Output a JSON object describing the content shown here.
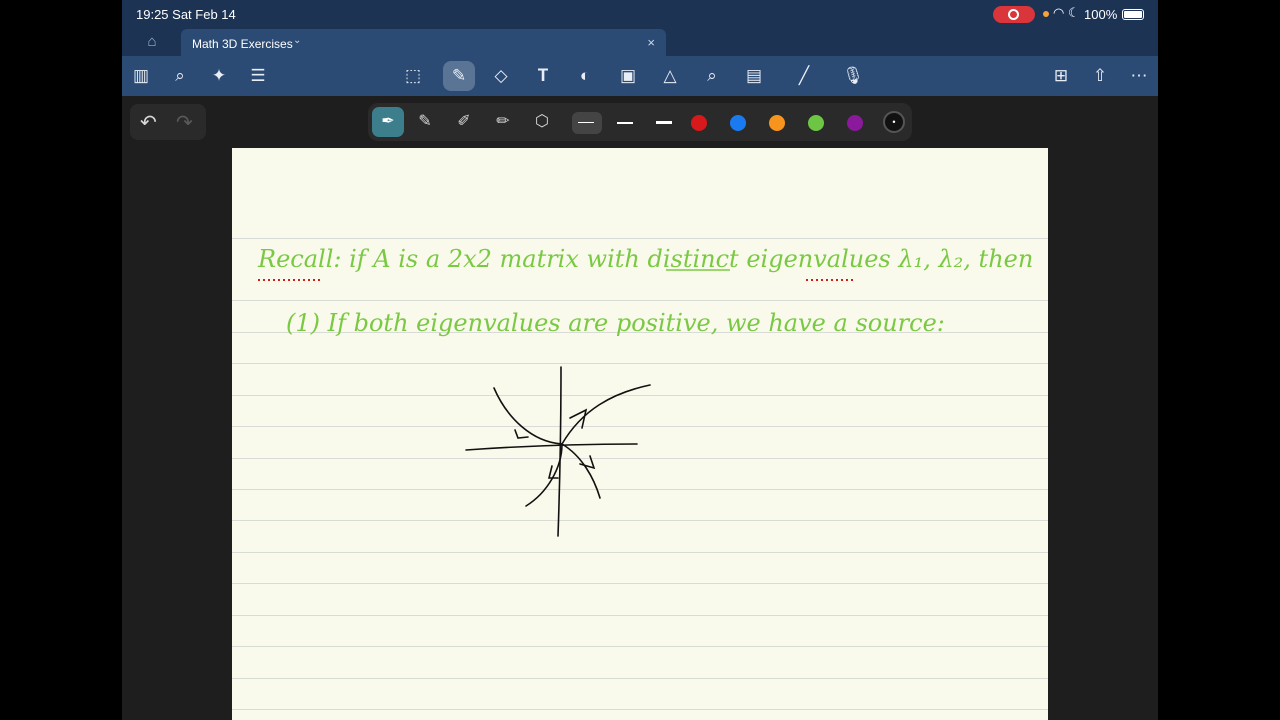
{
  "status_bar": {
    "time": "19:25  Sat Feb 14",
    "battery_pct": "100%"
  },
  "tab": {
    "title": "Math 3D Exercises",
    "chevron": "⌄",
    "close": "×"
  },
  "toolbar_icons": [
    "sidebar-icon",
    "search-icon",
    "ai-sparkle-icon",
    "document-icon",
    "lasso-icon",
    "pen-icon",
    "eraser-icon",
    "text-box-icon",
    "shapes-icon",
    "image-icon",
    "elements-icon",
    "highlighter-icon",
    "sticky-note-icon",
    "ruler-icon",
    "audio-record-icon",
    "add-page-icon",
    "share-icon",
    "more-icon"
  ],
  "pen_colors": [
    "#d7191c",
    "#1a7bf1",
    "#f7941d",
    "#6cc644",
    "#8a1a9b",
    "#111111"
  ],
  "note": {
    "line1": "Recall: if A is a 2x2 matrix with distinct eigenvalues λ₁, λ₂, then",
    "line2": "(1) If both eigenvalues are positive, we have a source:"
  }
}
